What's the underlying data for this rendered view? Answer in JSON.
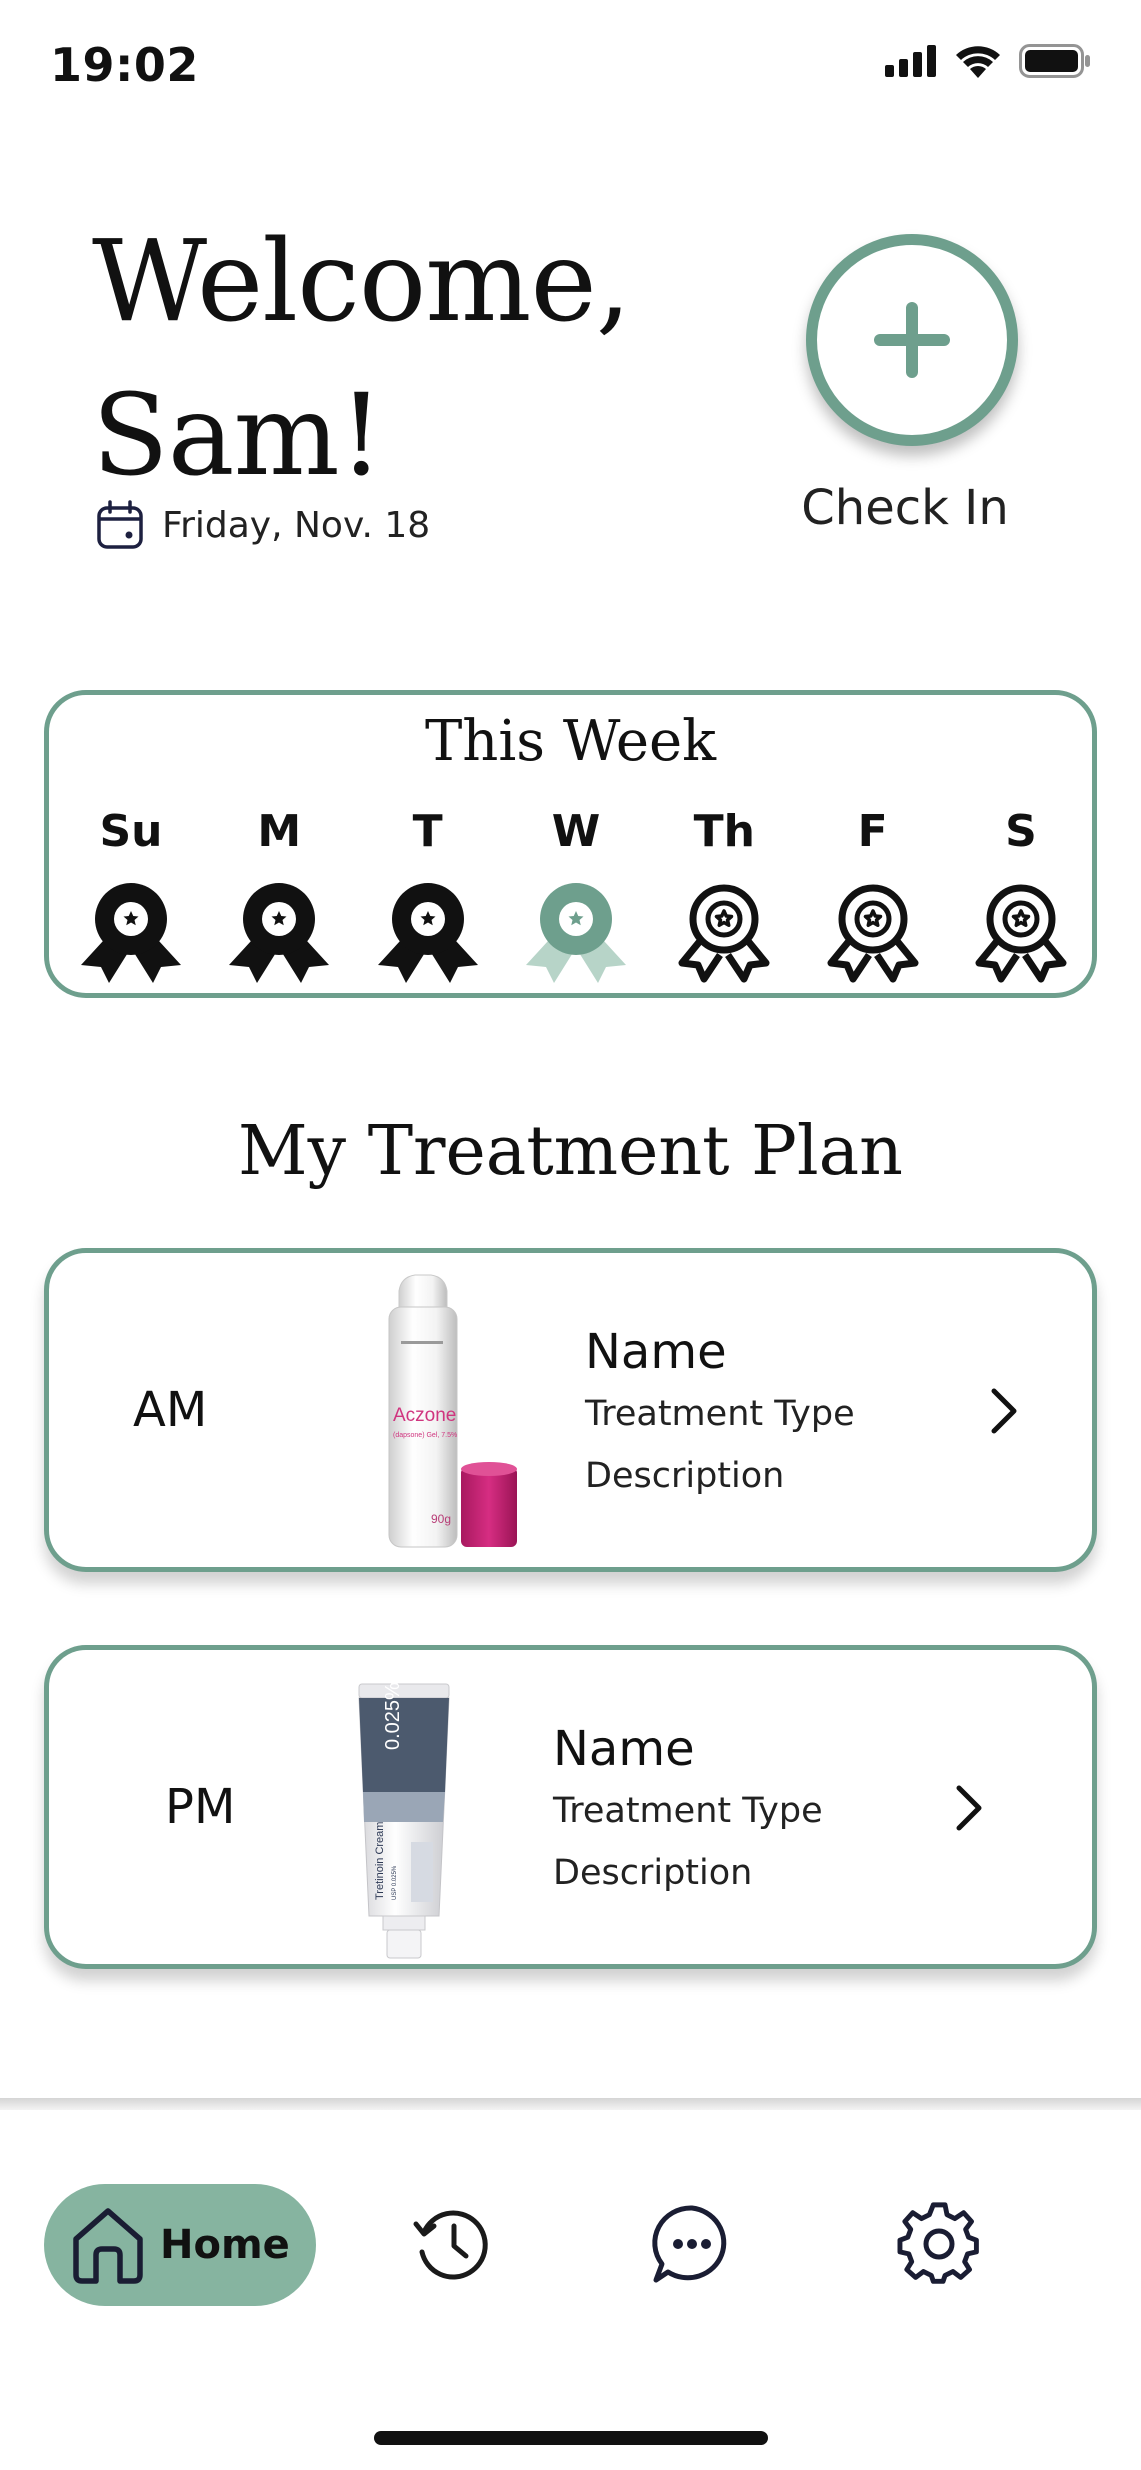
{
  "status_bar": {
    "time": "19:02"
  },
  "header": {
    "welcome_line1": "Welcome,",
    "welcome_line2": "Sam!",
    "date": "Friday, Nov. 18"
  },
  "check_in": {
    "label": "Check In"
  },
  "week": {
    "title": "This Week",
    "days": [
      {
        "label": "Su",
        "status": "completed"
      },
      {
        "label": "M",
        "status": "completed"
      },
      {
        "label": "T",
        "status": "completed"
      },
      {
        "label": "W",
        "status": "today"
      },
      {
        "label": "Th",
        "status": "upcoming"
      },
      {
        "label": "F",
        "status": "upcoming"
      },
      {
        "label": "S",
        "status": "upcoming"
      }
    ]
  },
  "treatment_plan": {
    "title": "My Treatment Plan",
    "items": [
      {
        "period": "AM",
        "name": "Name",
        "type": "Treatment Type",
        "description": "Description",
        "product_label": "Aczone",
        "product_sub": "(dapsone) Gel, 7.5%",
        "product_size": "90g"
      },
      {
        "period": "PM",
        "name": "Name",
        "type": "Treatment Type",
        "description": "Description",
        "product_label": "Tretinoin Cream",
        "product_sub": "USP 0.025%",
        "product_strength": "0.025%"
      }
    ]
  },
  "tab_bar": {
    "home_label": "Home"
  },
  "colors": {
    "accent": "#6e9f8d",
    "accent_fill": "#86b4a0",
    "accent_light": "#b7d4c8",
    "text": "#111111"
  },
  "icons": [
    "calendar-icon",
    "plus-icon",
    "award-badge-icon",
    "chevron-right-icon",
    "home-icon",
    "history-icon",
    "chat-icon",
    "gear-icon",
    "signal-icon",
    "wifi-icon",
    "battery-icon"
  ]
}
